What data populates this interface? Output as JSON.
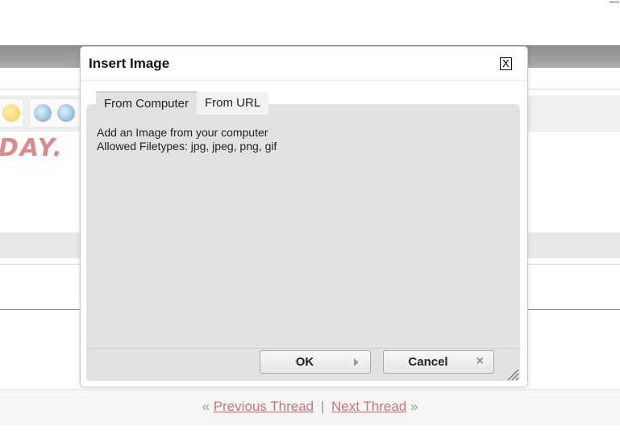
{
  "dialog": {
    "title": "Insert Image",
    "close_label": "X",
    "tabs": [
      {
        "label": "From Computer",
        "active": true
      },
      {
        "label": "From URL",
        "active": false
      }
    ],
    "description_line1": "Add an Image from your computer",
    "description_line2": "Allowed Filetypes: jpg, jpeg, png, gif",
    "ok_label": "OK",
    "cancel_label": "Cancel"
  },
  "background": {
    "banner_text": "DAY.",
    "thread_nav": {
      "prev_prefix": "«",
      "previous_label": "Previous Thread",
      "separator": "|",
      "next_label": "Next Thread",
      "next_suffix": "»"
    }
  },
  "colors": {
    "link": "#c27878",
    "panel": "#e2e2e2"
  }
}
